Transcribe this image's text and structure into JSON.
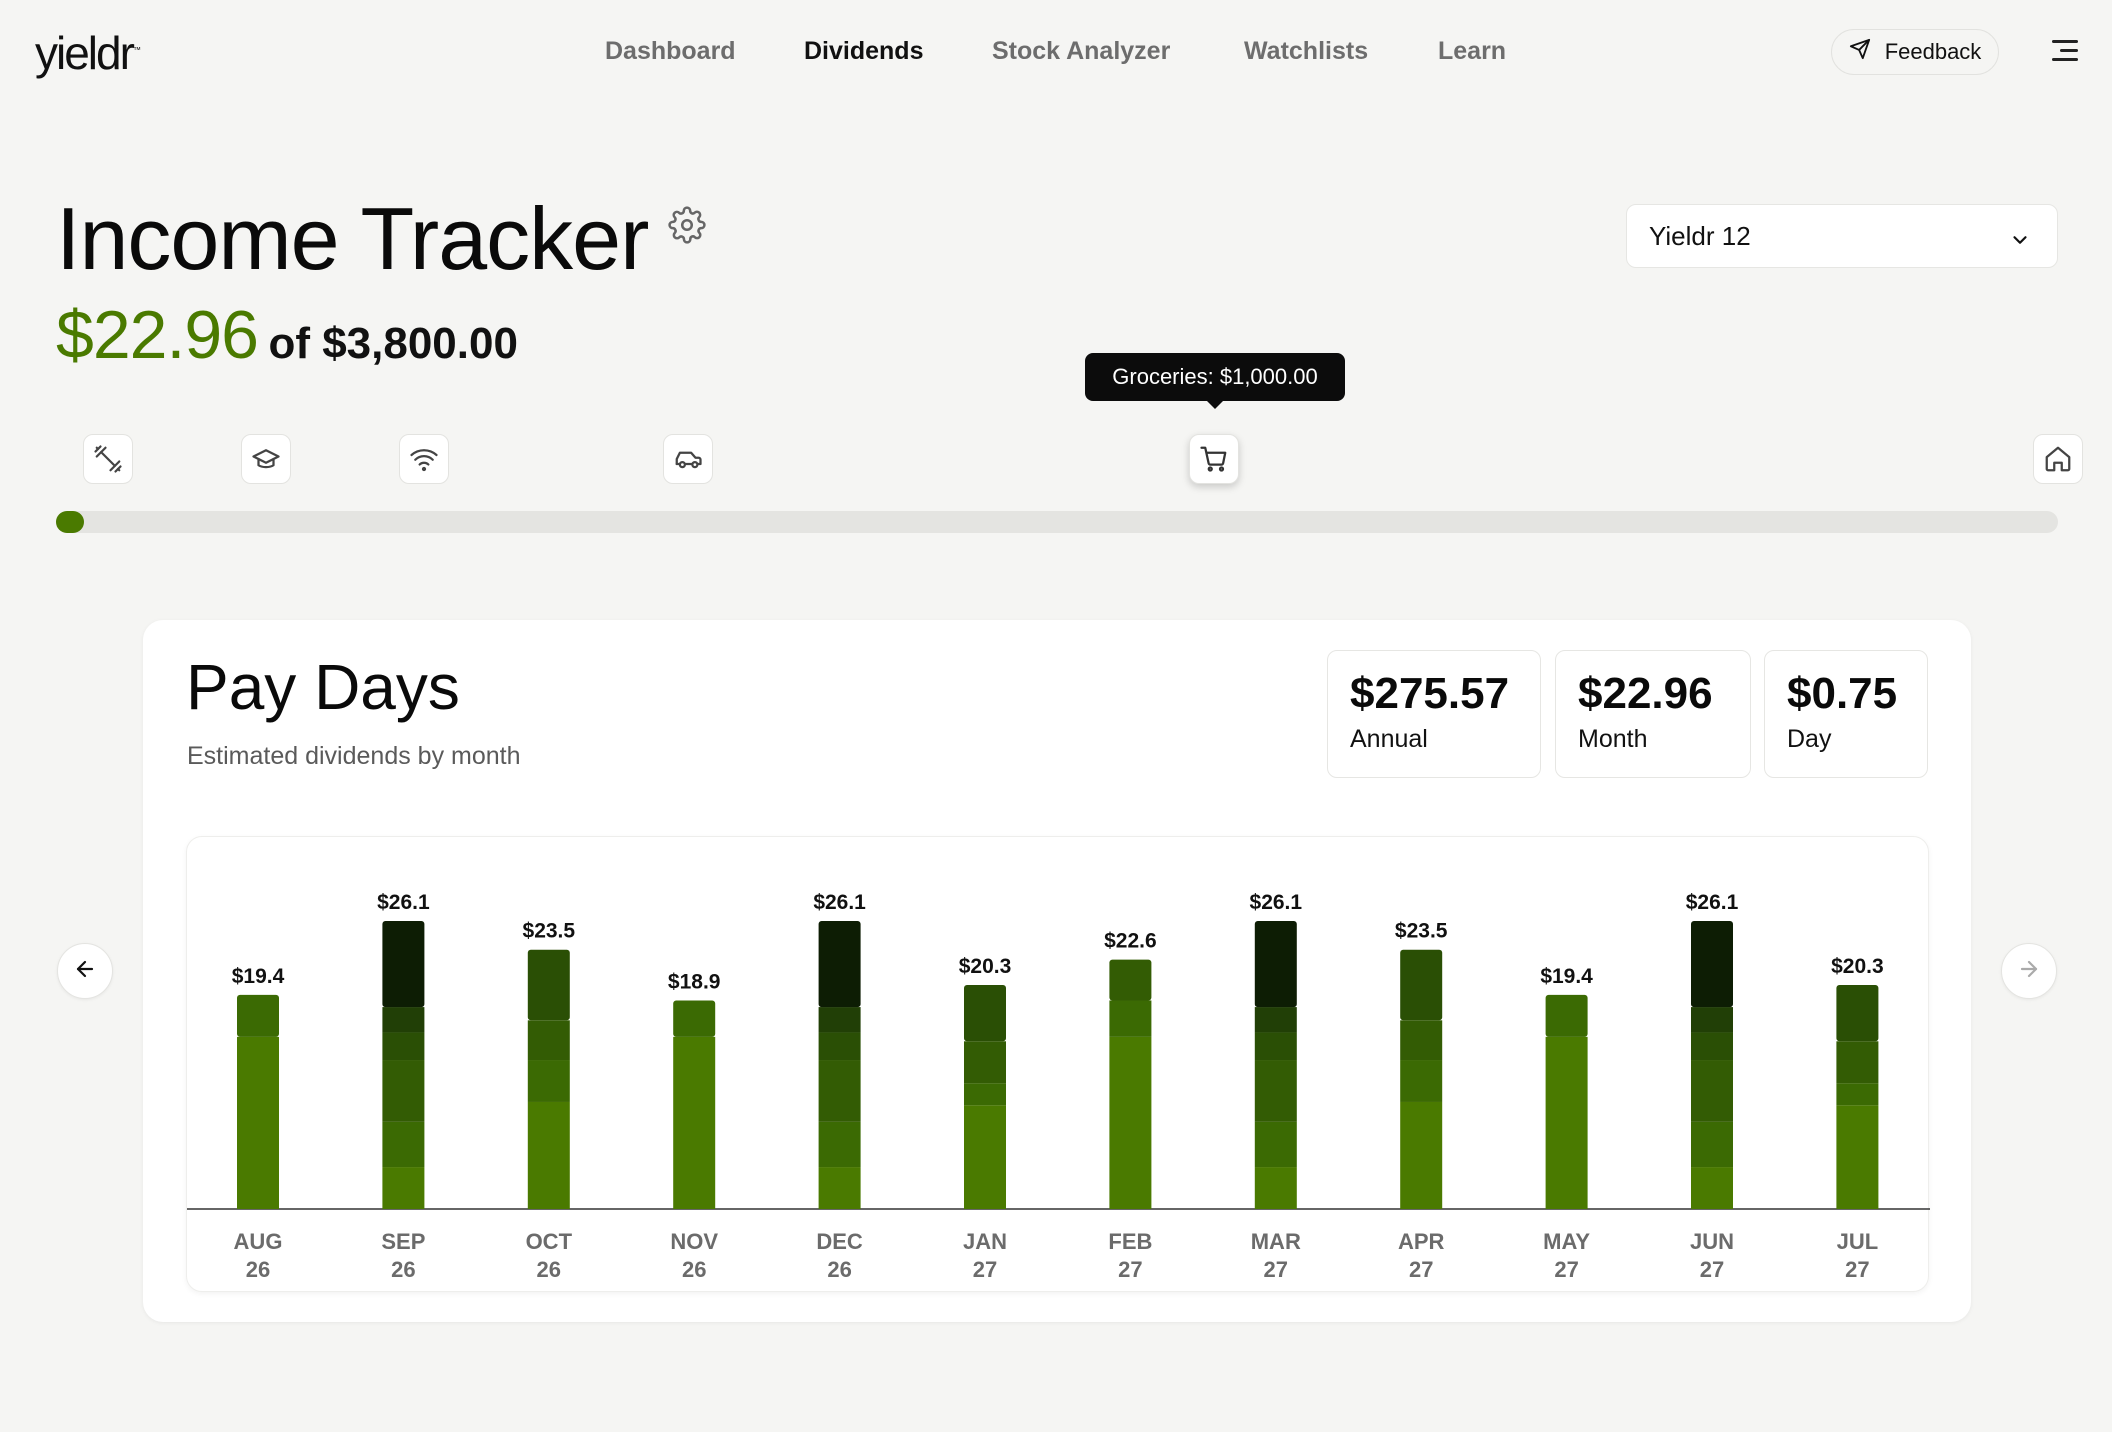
{
  "brand": {
    "logo_text": "yieldr"
  },
  "nav": {
    "items": [
      {
        "label": "Dashboard",
        "active": false
      },
      {
        "label": "Dividends",
        "active": true
      },
      {
        "label": "Stock Analyzer",
        "active": false
      },
      {
        "label": "Watchlists",
        "active": false
      },
      {
        "label": "Learn",
        "active": false
      }
    ],
    "feedback_label": "Feedback"
  },
  "header": {
    "title": "Income Tracker",
    "current_amount": "$22.96",
    "goal_text": "of $3,800.00"
  },
  "portfolio_select": {
    "value": "Yieldr 12"
  },
  "goals": {
    "icons": [
      "dumbbell-icon",
      "graduation-cap-icon",
      "wifi-icon",
      "car-icon",
      "shopping-cart-icon",
      "home-icon"
    ],
    "tooltip": "Groceries: $1,000.00",
    "progress_fraction": 0.006
  },
  "pay_days": {
    "title": "Pay Days",
    "subtitle": "Estimated dividends by month",
    "stats": [
      {
        "value": "$275.57",
        "label": "Annual"
      },
      {
        "value": "$22.96",
        "label": "Month"
      },
      {
        "value": "$0.75",
        "label": "Day"
      }
    ]
  },
  "colors": {
    "accent": "#4a7a00",
    "segments": [
      "#4a7a00",
      "#3b6a03",
      "#335c04",
      "#2a4f05",
      "#213f06",
      "#0d1d04"
    ]
  },
  "chart_data": {
    "type": "bar",
    "stacked": true,
    "categories": [
      [
        "AUG",
        "26"
      ],
      [
        "SEP",
        "26"
      ],
      [
        "OCT",
        "26"
      ],
      [
        "NOV",
        "26"
      ],
      [
        "DEC",
        "26"
      ],
      [
        "JAN",
        "27"
      ],
      [
        "FEB",
        "27"
      ],
      [
        "MAR",
        "27"
      ],
      [
        "APR",
        "27"
      ],
      [
        "MAY",
        "27"
      ],
      [
        "JUN",
        "27"
      ],
      [
        "JUL",
        "27"
      ]
    ],
    "totals": [
      19.4,
      26.1,
      23.5,
      18.9,
      26.1,
      20.3,
      22.6,
      26.1,
      23.5,
      19.4,
      26.1,
      20.3
    ],
    "value_labels": [
      "$19.4",
      "$26.1",
      "$23.5",
      "$18.9",
      "$26.1",
      "$20.3",
      "$22.6",
      "$26.1",
      "$23.5",
      "$19.4",
      "$26.1",
      "$20.3"
    ],
    "segments": [
      [
        15.6,
        3.8
      ],
      [
        3.8,
        4.1,
        5.6,
        2.5,
        2.3,
        7.8
      ],
      [
        9.7,
        3.8,
        3.6,
        6.4
      ],
      [
        15.6,
        3.3
      ],
      [
        3.8,
        4.1,
        5.6,
        2.5,
        2.3,
        7.8
      ],
      [
        9.4,
        2.0,
        3.8,
        5.1
      ],
      [
        15.6,
        3.3,
        3.7
      ],
      [
        3.8,
        4.1,
        5.6,
        2.5,
        2.3,
        7.8
      ],
      [
        9.7,
        3.8,
        3.6,
        6.4
      ],
      [
        15.6,
        3.8
      ],
      [
        3.8,
        4.1,
        5.6,
        2.5,
        2.3,
        7.8
      ],
      [
        9.4,
        2.0,
        3.8,
        5.1
      ]
    ],
    "ylim": [
      0,
      30
    ],
    "grid": false,
    "legend": "none"
  }
}
